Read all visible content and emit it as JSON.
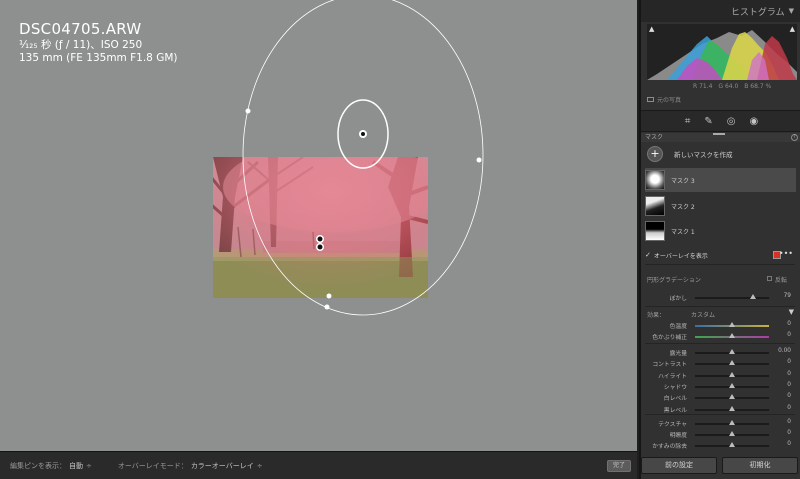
{
  "canvas": {
    "filename": "DSC04705.ARW",
    "shutter_fraction": "¹⁄₁₂₅",
    "shutter_rest": "秒 (ƒ / 11)、ISO 250",
    "lens_line": "135 mm (FE 135mm F1.8 GM)"
  },
  "bottombar": {
    "pin_label": "編集ピンを表示：",
    "pin_value": "自動",
    "overlay_mode_label": "オーバーレイモード：",
    "overlay_mode_value": "カラーオーバーレイ",
    "arrow": "÷",
    "done": "完了"
  },
  "panel": {
    "histogram_title": "ヒストグラム",
    "rgb_r_label": "R",
    "rgb_r": "71.4",
    "rgb_g_label": "G",
    "rgb_g": "64.0",
    "rgb_b_label": "B",
    "rgb_b": "68.7 %",
    "original_photo": "元の写真",
    "mask_header": "マスク",
    "help": "?",
    "new_mask": "新しいマスクを作成",
    "masks": [
      {
        "label": "マスク 3",
        "selected": true
      },
      {
        "label": "マスク 2",
        "selected": false
      },
      {
        "label": "マスク 1",
        "selected": false
      }
    ],
    "show_overlay": "オーバーレイを表示",
    "overlay_color": "#d93025",
    "radial_gradient": "円形グラデーション",
    "invert": "反転",
    "feather_label": "ぼかし",
    "feather_value": "79",
    "feather_level": 0.79,
    "effect_label": "効果：",
    "effect_value": "カスタム",
    "sliders_a": [
      {
        "label": "色温度",
        "value": "0"
      },
      {
        "label": "色かぶり補正",
        "value": "0"
      }
    ],
    "sliders_b": [
      {
        "label": "露光量",
        "value": "0.00"
      },
      {
        "label": "コントラスト",
        "value": "0"
      },
      {
        "label": "ハイライト",
        "value": "0"
      },
      {
        "label": "シャドウ",
        "value": "0"
      },
      {
        "label": "白レベル",
        "value": "0"
      },
      {
        "label": "黒レベル",
        "value": "0"
      }
    ],
    "sliders_c": [
      {
        "label": "テクスチャ",
        "value": "0"
      },
      {
        "label": "明瞭度",
        "value": "0"
      },
      {
        "label": "かすみの除去",
        "value": "0"
      }
    ],
    "prev_settings": "前の設定",
    "reset": "初期化"
  }
}
